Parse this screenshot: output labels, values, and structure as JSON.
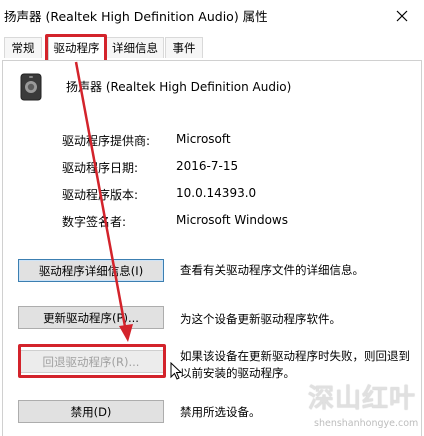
{
  "window": {
    "title": "扬声器 (Realtek High Definition Audio) 属性",
    "close_icon": "close-icon"
  },
  "tabs": [
    {
      "label": "常规",
      "active": false
    },
    {
      "label": "驱动程序",
      "active": true
    },
    {
      "label": "详细信息",
      "active": false
    },
    {
      "label": "事件",
      "active": false
    }
  ],
  "device": {
    "icon": "speaker-icon",
    "name": "扬声器 (Realtek High Definition Audio)"
  },
  "driver_info": [
    {
      "label": "驱动程序提供商:",
      "value": "Microsoft"
    },
    {
      "label": "驱动程序日期:",
      "value": "2016-7-15"
    },
    {
      "label": "驱动程序版本:",
      "value": "10.0.14393.0"
    },
    {
      "label": "数字签名者:",
      "value": "Microsoft Windows"
    }
  ],
  "actions": [
    {
      "button": "驱动程序详细信息(I)",
      "desc_lines": [
        "查看有关驱动程序文件的详细信息。"
      ],
      "enabled": true
    },
    {
      "button": "更新驱动程序(P)...",
      "desc_lines": [
        "为这个设备更新驱动程序软件。"
      ],
      "enabled": true
    },
    {
      "button": "回退驱动程序(R)...",
      "desc_lines": [
        "如果该设备在更新驱动程序时失败，则回退到",
        "以前安装的驱动程序。"
      ],
      "enabled": false
    },
    {
      "button": "禁用(D)",
      "desc_lines": [
        "禁用所选设备。"
      ],
      "enabled": true
    }
  ],
  "annotation": {
    "highlight_color": "#d3232b"
  },
  "watermark": {
    "main": "深山红叶",
    "sub": "shenshanhongye.com"
  }
}
